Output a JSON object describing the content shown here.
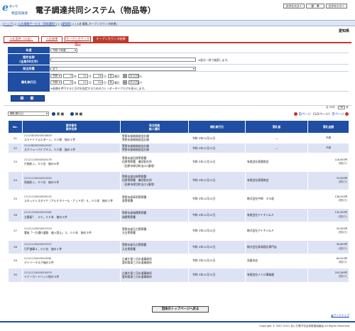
{
  "header": {
    "logo_mark": "e",
    "logo_text": "あいち",
    "logo_sub": "物品等調達",
    "title": "電子調達共同システム（物品等）",
    "btn_big": "文字を大きく",
    "btn_std": "標　準",
    "btn_small": "文字を小さく"
  },
  "breadcrumb": {
    "link1": "トップ",
    "sep1": " > ",
    "link2": "入札情報サービス（団体選択）",
    "sep2": " > ",
    "link3": "愛知県",
    "sep3": " > ",
    "current": "入札情報-オープンカウンタ結果"
  },
  "prefecture": "愛知県",
  "tabs": [
    "入札案件（公告）",
    "入札結果",
    "オープンカウンタ案件",
    "オープンカウンタ結果"
  ],
  "form": {
    "year_label": "年度",
    "year_value": "令和 3年度",
    "case_label_1": "案件名称",
    "case_label_2": "(全角50文字)",
    "case_note": "※部分一致で検索します。",
    "org_label": "発注所属",
    "org_value": "全て",
    "date_label": "開札執行日",
    "from_era": "令和",
    "from_y": "3",
    "from_m": "11",
    "from_d": "16",
    "to_era": "令和",
    "to_y": "3",
    "to_m": "11",
    "to_d": "24",
    "unit_y": "年",
    "unit_m": "月",
    "unit_d": "日",
    "from_dow": "水",
    "to_dow": "木",
    "dow_suffix": "曜日",
    "clear": "クリア",
    "from_suffix": "から",
    "to_suffix": "まで",
    "date_note": "※画像を押下すると日付を指定するためのカレンダーダイアログを表示します。",
    "search_btn": "検　索"
  },
  "sort": {
    "select_value": "開札執行日",
    "asc": "昇 順",
    "desc": "降 順",
    "count": "全 30件",
    "perpage": "10",
    "perpage_unit": "件",
    "prev": "前ページ",
    "pages": "1/2ページ",
    "next": "次ページ"
  },
  "table": {
    "headers": [
      "No.",
      "案件番号\n案件名称",
      "発注所属\n納入場所",
      "開札執行日",
      "落札者",
      "落札金額"
    ],
    "rows": [
      {
        "no": "21",
        "num": "211108230000518819",
        "name": "スライドフォルダー１，００冊　抽の２件",
        "org": "警察本部総務部会計課",
        "place": "警察本部総務部会計課",
        "date": "令和 3年11月22日",
        "winner": "―",
        "amount": "不調",
        "tax": ""
      },
      {
        "no": "22",
        "num": "211108230000519167",
        "name": "スクリューパイプＡ３，００冊　抽の１件",
        "org": "警察本部総務部会計課",
        "place": "警察本部総務部会計課",
        "date": "令和 3年11月22日",
        "winner": "―",
        "amount": "不調",
        "tax": ""
      },
      {
        "no": "23",
        "num": "211111230000529276",
        "name": "片袖机１，００台　抽の６件",
        "org": "警察本部田原警察署",
        "place": "田原警察署　儀切駐在所\n（田原市保切町出口1番地）",
        "date": "令和 3年11月22日",
        "winner": "有限会社東陽商会",
        "amount": "116,000円",
        "tax": "(税抜き)"
      },
      {
        "no": "24",
        "num": "211111230000529254",
        "name": "両袖机１，００台　抽の６件",
        "org": "警察本部田原警察署",
        "place": "田原警察署　儀切駐在所\n（田原市保切町出口1番地）",
        "date": "令和 3年11月22日",
        "winner": "有限会社東陽商会",
        "amount": "79,500円",
        "tax": "(税抜き)"
      },
      {
        "no": "25",
        "num": "211111230000539132",
        "name": "スタッドレスタイヤ（アルミホイール・ナット付）４，００本　抽の２件",
        "org": "警察本部車両警察署",
        "place": "東警察署",
        "date": "令和 3年11月22日",
        "winner": "株式会社中﨑　ＳＳ部",
        "amount": "136,200円",
        "tax": "(税抜き)"
      },
      {
        "no": "26",
        "num": "211112230000519362",
        "name": "立看板？　２０，００本　抽の２件",
        "org": "警察本部瑞穂警察署",
        "place": "瑞穂警察署",
        "date": "令和 3年11月22日",
        "winner": "有限会社アイチジムキ",
        "amount": "132,000円",
        "tax": "(税抜き)"
      },
      {
        "no": "27",
        "num": "211111230000519374",
        "name": "看板「一方通行道路　進入禁止」２，００本　抽の５件",
        "org": "警察本部天白警察署",
        "place": "天白警察署",
        "date": "令和 3年11月22日",
        "winner": "株式会社アイチジムキ",
        "amount": "33,000円",
        "tax": "(税抜き)"
      },
      {
        "no": "28",
        "num": "211111230000519372",
        "name": "引戸書庫３，００台　抽の１件",
        "org": "警察本部天白警察署",
        "place": "天白警察署",
        "date": "令和 3年11月22日",
        "winner": "株式会社東海国北専門店",
        "amount": "39,600円",
        "tax": "(税抜き)"
      },
      {
        "no": "29",
        "num": "211111230000519081",
        "name": "デイリーマスク抽の２件",
        "org": "企業庁東三河水道事務所",
        "place": "愛知県東三河水道事務所",
        "date": "令和 3年11月22日",
        "winner": "深屋本店",
        "amount": "85,920円",
        "tax": "(税抜き)"
      },
      {
        "no": "30",
        "num": "211111230000519079",
        "name": "トナーカートリッジ他の４件",
        "org": "企業庁東三河水道事務所",
        "place": "愛知県東三河水道事務所",
        "date": "令和 3年11月22日",
        "winner": "有限会社メトロ事務器",
        "amount": "253,280円",
        "tax": "(税抜き)"
      }
    ]
  },
  "footer": {
    "top_btn": "団体のトップページへ戻る",
    "page_top": "▲ページトップ",
    "copyright": "Copyright © 2007-2021 あいち電子自治体推進協議会 All Rights Reserved"
  },
  "colors": {
    "primary": "#1f4ea3",
    "accent": "#c0392b",
    "row_alt": "#dde3f4"
  }
}
